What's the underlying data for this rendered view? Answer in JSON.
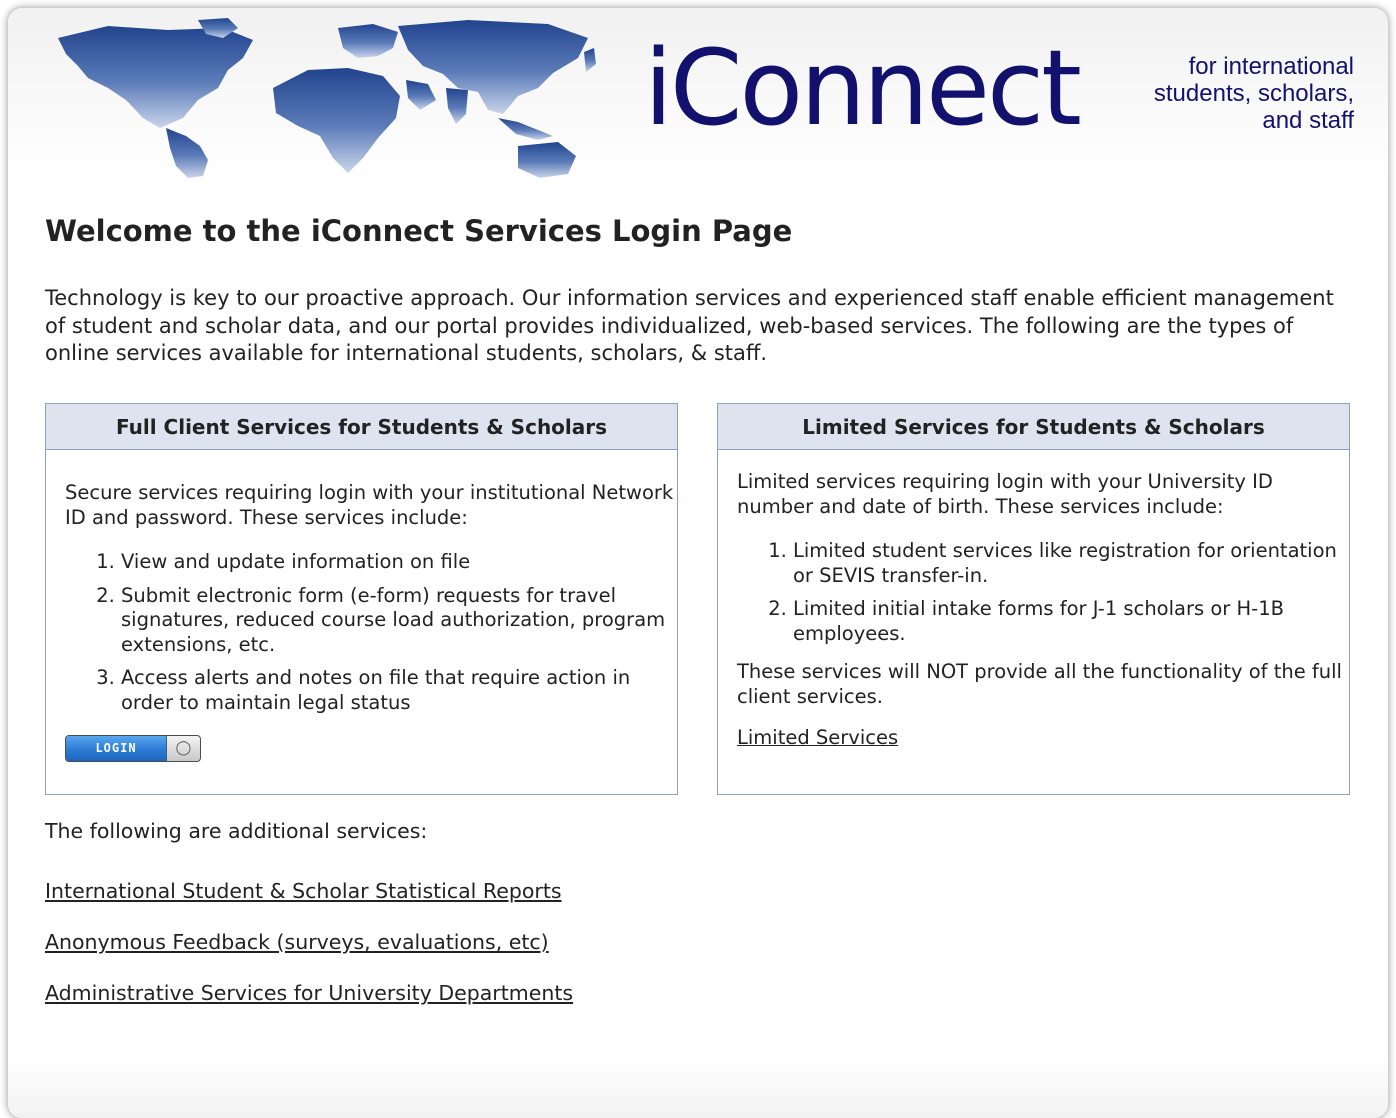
{
  "banner": {
    "logo_text": "iConnect",
    "tagline": "for international\nstudents, scholars,\nand staff"
  },
  "page": {
    "title": "Welcome to the iConnect Services Login Page",
    "intro": "Technology is key to our proactive approach. Our information services and experienced staff enable efficient management of student and scholar data, and our portal provides individualized, web-based services. The following are the types of online services available for international students, scholars, & staff."
  },
  "full_client": {
    "header": "Full Client Services for Students & Scholars",
    "description": "Secure services requiring login with your institutional Network ID and password. These services include:",
    "items": [
      "View and update information on file",
      "Submit electronic form (e-form) requests for travel signatures, reduced course load authorization, program extensions, etc.",
      "Access alerts and notes on file that require action in order to maintain legal status"
    ],
    "login_label": "LOGIN"
  },
  "limited": {
    "header": "Limited Services for Students & Scholars",
    "description": "Limited services requiring login with your University ID number and date of birth. These services include:",
    "items": [
      "Limited student services like registration for orientation or SEVIS transfer-in.",
      "Limited initial intake forms for J-1 scholars or H-1B employees."
    ],
    "note": "These services will NOT provide all the functionality of the full client services.",
    "link_label": "Limited Services"
  },
  "additional": {
    "intro": "The following are additional services:",
    "links": [
      "International Student & Scholar Statistical Reports",
      "Anonymous Feedback (surveys, evaluations, etc)",
      "Administrative Services for University Departments"
    ]
  },
  "colors": {
    "logo": "#13116e",
    "panel_header_bg": "#dde4ef",
    "panel_border": "#8aa2bb",
    "login_blue": "#2f7fd6"
  }
}
